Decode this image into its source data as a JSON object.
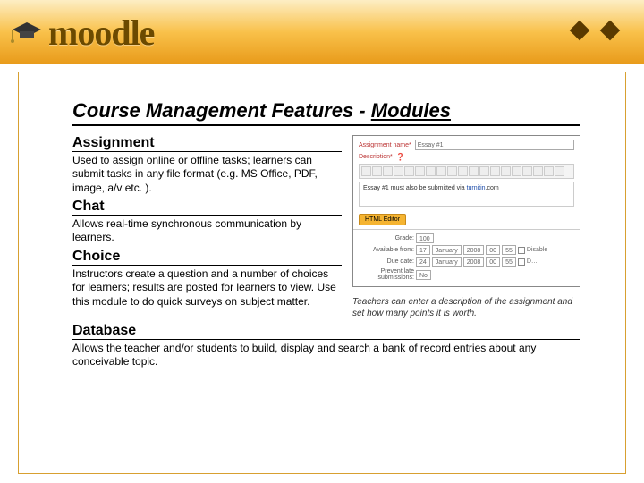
{
  "brand": {
    "name": "moodle"
  },
  "title": {
    "prefix": "Course Management Features - ",
    "emphasis": "Modules"
  },
  "modules": {
    "assignment": {
      "heading": "Assignment",
      "desc": "Used to assign online or offline tasks; learners can submit tasks in any file format (e.g. MS Office, PDF, image, a/v etc. )."
    },
    "chat": {
      "heading": "Chat",
      "desc": "Allows real-time synchronous communication by learners."
    },
    "choice": {
      "heading": "Choice",
      "desc": "Instructors create a question and a number of choices for learners; results are posted for learners to view. Use this module to do quick surveys on subject matter."
    },
    "database": {
      "heading": "Database",
      "desc": "Allows the teacher and/or students to build, display and search a bank of record entries about any conceivable topic."
    }
  },
  "screenshot": {
    "label_name": "Assignment name*",
    "value_name": "Essay #1",
    "label_desc": "Description*",
    "editor_text_prefix": "Essay #1 must also be submitted via ",
    "editor_text_link": "turnitin",
    "editor_text_suffix": ".com",
    "badge": "HTML Editor",
    "grade_label": "Grade:",
    "grade_value": "100",
    "avail_label": "Available from:",
    "due_label": "Due date:",
    "prevent_label": "Prevent late submissions:",
    "prevent_value": "No",
    "date1": {
      "day": "17",
      "month": "January",
      "year": "2008",
      "hour": "00",
      "min": "55"
    },
    "date2": {
      "day": "24",
      "month": "January",
      "year": "2008",
      "hour": "00",
      "min": "55"
    },
    "disable1": "Disable",
    "disable2": "D…"
  },
  "caption": "Teachers can enter a description of the assignment and set how many points it is worth."
}
